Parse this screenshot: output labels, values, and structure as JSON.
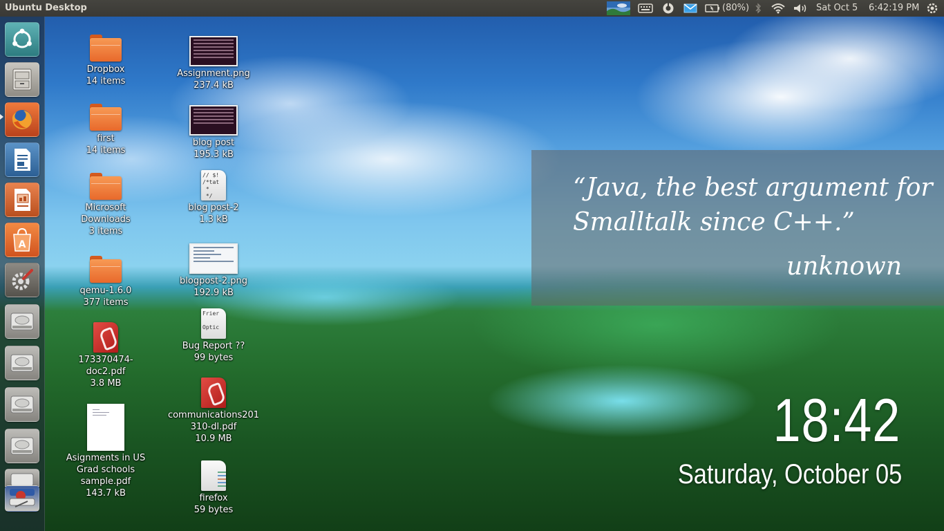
{
  "panel": {
    "title": "Ubuntu Desktop",
    "battery": "(80%)",
    "date": "Sat Oct  5",
    "time": "6:42:19 PM"
  },
  "launcher": {
    "items": [
      {
        "name": "dash-home",
        "icon": "ubuntu-logo-icon"
      },
      {
        "name": "files",
        "icon": "file-cabinet-icon"
      },
      {
        "name": "firefox",
        "icon": "firefox-icon",
        "running": true
      },
      {
        "name": "writer",
        "icon": "document-icon"
      },
      {
        "name": "impress",
        "icon": "presentation-icon"
      },
      {
        "name": "software-center",
        "icon": "shopping-bag-icon"
      },
      {
        "name": "system-settings",
        "icon": "gear-wrench-icon"
      },
      {
        "name": "drive-1",
        "icon": "hard-drive-icon"
      },
      {
        "name": "drive-2",
        "icon": "hard-drive-icon"
      },
      {
        "name": "drive-3",
        "icon": "hard-drive-icon"
      },
      {
        "name": "drive-4",
        "icon": "hard-drive-icon"
      },
      {
        "name": "stacked",
        "icon": "stacked-apps-icon"
      }
    ]
  },
  "desktop": {
    "col1": [
      {
        "name": "Dropbox",
        "meta": "14 items",
        "type": "folder"
      },
      {
        "name": "first",
        "meta": "14 items",
        "type": "folder"
      },
      {
        "name": "Microsoft Downloads",
        "meta": "3 items",
        "type": "folder"
      },
      {
        "name": "qemu-1.6.0",
        "meta": "377 items",
        "type": "folder"
      },
      {
        "name": "173370474-doc2.pdf",
        "meta": "3.8 MB",
        "type": "pdf"
      },
      {
        "name": "Asignments in US Grad schools sample.pdf",
        "meta": "143.7 kB",
        "type": "paper"
      }
    ],
    "col2": [
      {
        "name": "Assignment.png",
        "meta": "237.4 kB",
        "type": "image"
      },
      {
        "name": "blog post",
        "meta": "195.3 kB",
        "type": "image"
      },
      {
        "name": "blog post-2",
        "meta": "1.3 kB",
        "type": "text",
        "preview": "// $!\n/*tat\n *\n */"
      },
      {
        "name": "blogpost-2.png",
        "meta": "192.9 kB",
        "type": "image-light"
      },
      {
        "name": "Bug Report ??",
        "meta": "99 bytes",
        "type": "text",
        "preview": "Frier\n\nOptic"
      },
      {
        "name": "communications201310-dl.pdf",
        "meta": "10.9 MB",
        "type": "pdf"
      },
      {
        "name": "firefox",
        "meta": "59 bytes",
        "type": "text-lines"
      }
    ]
  },
  "quote": {
    "line1": "“Java, the best argument for",
    "line2": "Smalltalk since C++.”",
    "author": "unknown"
  },
  "clock": {
    "time": "18:42",
    "date": "Saturday, October 05"
  },
  "colors": {
    "panel": "#3c3b37",
    "folder": "#f0762f",
    "launcher_bg": "rgba(30,42,54,.62)"
  }
}
